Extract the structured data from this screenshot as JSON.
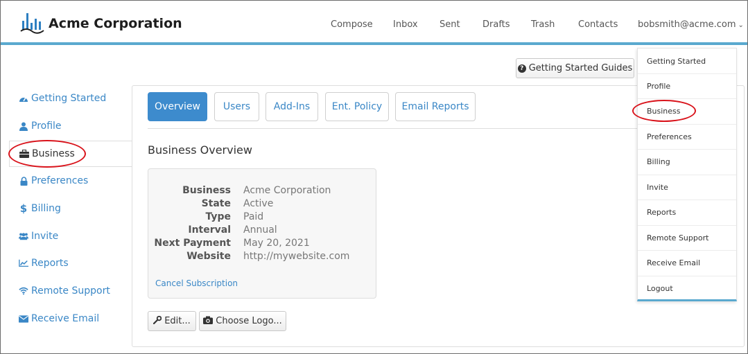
{
  "header": {
    "brand": "Acme Corporation",
    "nav": [
      "Compose",
      "Inbox",
      "Sent",
      "Drafts",
      "Trash",
      "Contacts"
    ],
    "user_email": "bobsmith@acme.com",
    "accent_color": "#5aa9cf"
  },
  "toolbar": {
    "guides_label": "Getting Started Guides",
    "guides_icon": "question-circle-icon"
  },
  "sidebar": {
    "items": [
      {
        "label": "Getting Started",
        "icon": "dashboard-icon",
        "active": false
      },
      {
        "label": "Profile",
        "icon": "user-icon",
        "active": false
      },
      {
        "label": "Business",
        "icon": "briefcase-icon",
        "active": true
      },
      {
        "label": "Preferences",
        "icon": "lock-icon",
        "active": false
      },
      {
        "label": "Billing",
        "icon": "dollar-icon",
        "active": false
      },
      {
        "label": "Invite",
        "icon": "users-icon",
        "active": false
      },
      {
        "label": "Reports",
        "icon": "line-chart-icon",
        "active": false
      },
      {
        "label": "Remote Support",
        "icon": "wifi-icon",
        "active": false
      },
      {
        "label": "Receive Email",
        "icon": "envelope-icon",
        "active": false
      }
    ]
  },
  "main": {
    "tabs": [
      {
        "label": "Overview",
        "active": true
      },
      {
        "label": "Users",
        "active": false
      },
      {
        "label": "Add-Ins",
        "active": false
      },
      {
        "label": "Ent. Policy",
        "active": false
      },
      {
        "label": "Email Reports",
        "active": false
      }
    ],
    "section_title": "Business Overview",
    "details": [
      {
        "key": "Business",
        "value": "Acme Corporation"
      },
      {
        "key": "State",
        "value": "Active"
      },
      {
        "key": "Type",
        "value": "Paid"
      },
      {
        "key": "Interval",
        "value": "Annual"
      },
      {
        "key": "Next Payment",
        "value": "May 20, 2021"
      },
      {
        "key": "Website",
        "value": "http://mywebsite.com"
      }
    ],
    "cancel_label": "Cancel Subscription",
    "edit_label": "Edit...",
    "logo_label": "Choose Logo..."
  },
  "dropdown": {
    "items": [
      "Getting Started",
      "Profile",
      "Business",
      "Preferences",
      "Billing",
      "Invite",
      "Reports",
      "Remote Support",
      "Receive Email",
      "Logout"
    ]
  }
}
